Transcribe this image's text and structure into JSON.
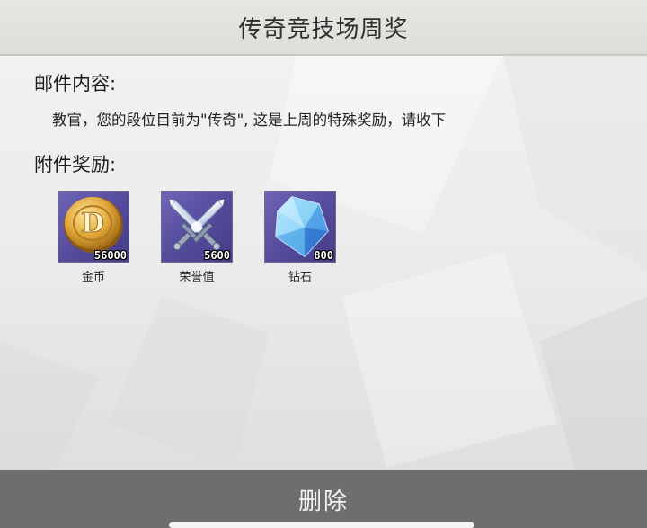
{
  "header": {
    "title": "传奇竞技场周奖"
  },
  "mail": {
    "content_label": "邮件内容:",
    "body": "教官，您的段位目前为\"传奇\", 这是上周的特殊奖励，请收下",
    "attachments_label": "附件奖励:"
  },
  "rewards": [
    {
      "icon": "gold-coin-icon",
      "count": "56000",
      "name": "金币"
    },
    {
      "icon": "crossed-swords-icon",
      "count": "5600",
      "name": "荣誉值"
    },
    {
      "icon": "diamond-icon",
      "count": "800",
      "name": "钻石"
    }
  ],
  "footer": {
    "delete_label": "删除"
  },
  "colors": {
    "title_bar": "#e2e2de",
    "delete_bar": "#6e6e6e",
    "reward_frame": "#5a50a2"
  }
}
